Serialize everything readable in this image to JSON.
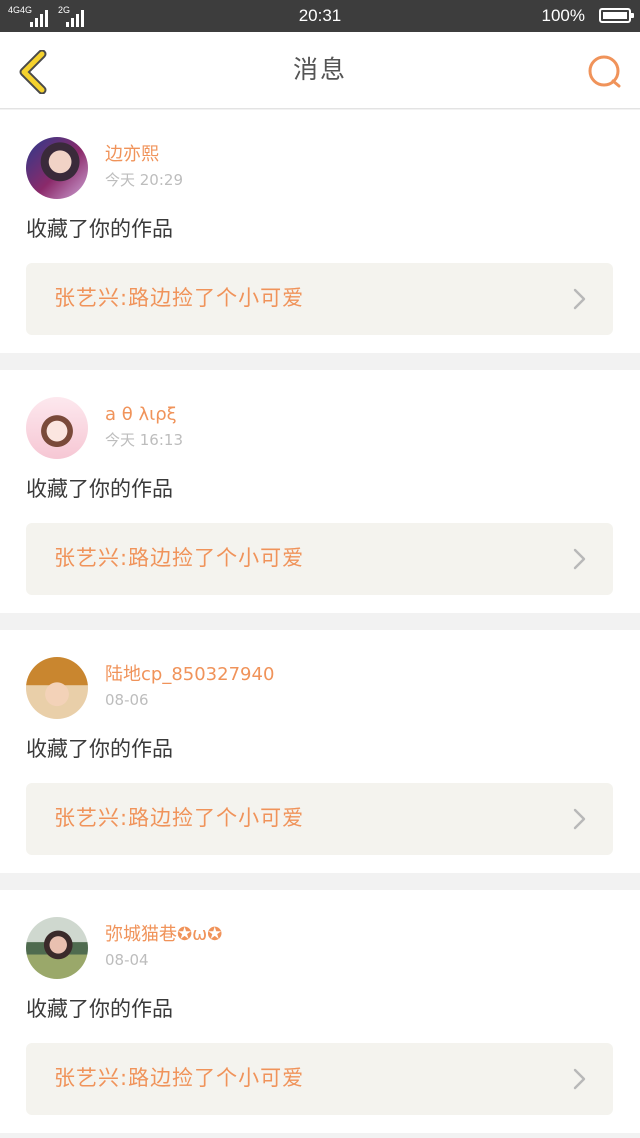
{
  "status_bar": {
    "network_1": "4G",
    "network_1b": "4G",
    "network_2": "2G",
    "time": "20:31",
    "battery": "100%"
  },
  "header": {
    "title": "消息",
    "back_icon": "chevron-left-icon",
    "search_icon": "search-icon"
  },
  "colors": {
    "accent": "#f0935a",
    "back_arrow": "#f5c518",
    "card_link_bg": "#f4f3ee",
    "separator": "#f2f2f2"
  },
  "messages": [
    {
      "username": "边亦熙",
      "time": "今天 20:29",
      "action": "收藏了你的作品",
      "work_title": "张艺兴:路边捡了个小可爱",
      "avatar": "user-avatar"
    },
    {
      "username": "a θ λιρξ",
      "time": "今天 16:13",
      "action": "收藏了你的作品",
      "work_title": "张艺兴:路边捡了个小可爱",
      "avatar": "user-avatar"
    },
    {
      "username": "陆地cp_850327940",
      "time": "08-06",
      "action": "收藏了你的作品",
      "work_title": "张艺兴:路边捡了个小可爱",
      "avatar": "user-avatar"
    },
    {
      "username": "弥城猫巷✪ω✪",
      "time": "08-04",
      "action": "收藏了你的作品",
      "work_title": "张艺兴:路边捡了个小可爱",
      "avatar": "user-avatar"
    }
  ]
}
